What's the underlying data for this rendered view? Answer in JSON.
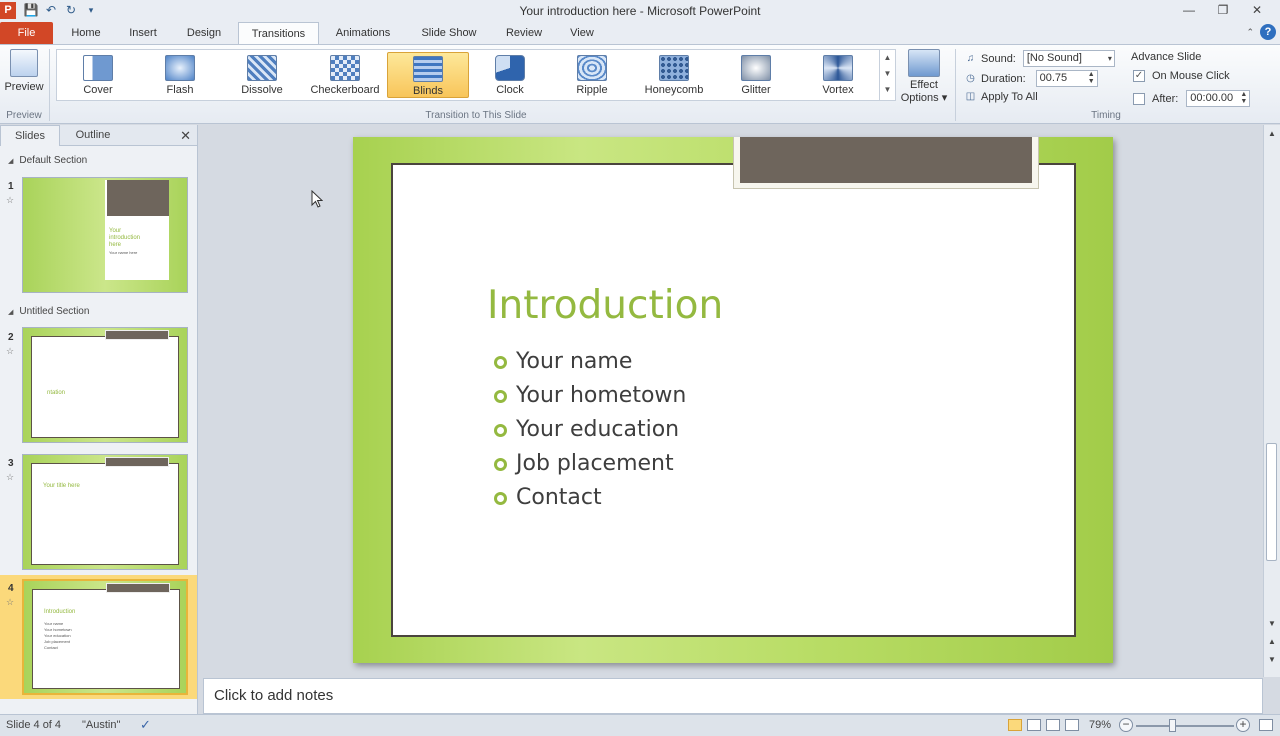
{
  "titlebar": {
    "app_icon": "P",
    "title": "Your introduction here - Microsoft PowerPoint",
    "qat_icons": [
      "save-icon",
      "undo-icon",
      "redo-icon",
      "customize-icon"
    ]
  },
  "tabs": {
    "file": "File",
    "items": [
      "Home",
      "Insert",
      "Design",
      "Transitions",
      "Animations",
      "Slide Show",
      "Review",
      "View"
    ],
    "active": "Transitions"
  },
  "ribbon": {
    "preview": {
      "label": "Preview",
      "group": "Preview"
    },
    "transitions": {
      "group": "Transition to This Slide",
      "items": [
        "Cover",
        "Flash",
        "Dissolve",
        "Checkerboard",
        "Blinds",
        "Clock",
        "Ripple",
        "Honeycomb",
        "Glitter",
        "Vortex"
      ],
      "selected": "Blinds"
    },
    "effect_options": {
      "line1": "Effect",
      "line2": "Options"
    },
    "timing": {
      "group": "Timing",
      "sound_label": "Sound:",
      "sound_value": "[No Sound]",
      "duration_label": "Duration:",
      "duration_value": "00.75",
      "apply_all": "Apply To All",
      "advance_title": "Advance Slide",
      "on_mouse_click": "On Mouse Click",
      "on_mouse_click_checked": true,
      "after_label": "After:",
      "after_value": "00:00.00",
      "after_checked": false
    }
  },
  "left_panel": {
    "tabs": [
      "Slides",
      "Outline"
    ],
    "active_tab": "Slides",
    "sections": [
      "Default Section",
      "Untitled Section"
    ],
    "slides": [
      {
        "num": "1",
        "title_lines": [
          "Your",
          "introduction",
          "here"
        ],
        "sub": "Your name here"
      },
      {
        "num": "2",
        "title": "ntation"
      },
      {
        "num": "3",
        "title": "Your title here"
      },
      {
        "num": "4",
        "title": "Introduction",
        "bullets": [
          "Your name",
          "Your hometown",
          "Your education",
          "Job placement",
          "Contact"
        ]
      }
    ],
    "selected_slide": "4"
  },
  "slide": {
    "title": "Introduction",
    "bullets": [
      "Your name",
      "Your hometown",
      "Your education",
      "Job placement",
      "Contact"
    ]
  },
  "notes": {
    "placeholder": "Click to add notes"
  },
  "statusbar": {
    "slide_info": "Slide 4 of 4",
    "theme": "\"Austin\"",
    "zoom": "79%"
  },
  "colors": {
    "accent_green": "#94b940",
    "file_tab": "#d24726",
    "selected_gold": "#fbd97b"
  }
}
